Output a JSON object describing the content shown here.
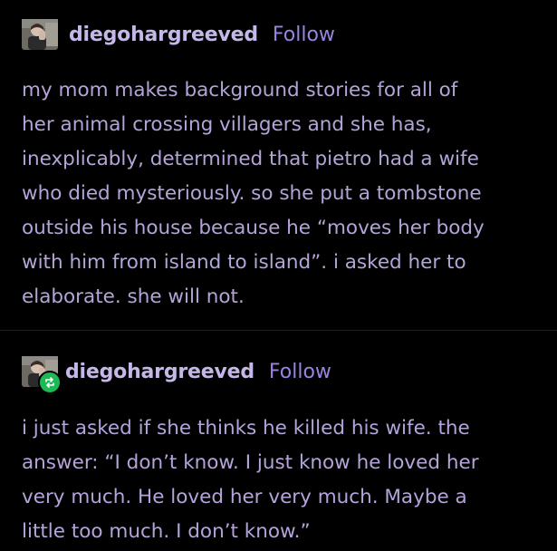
{
  "posts": [
    {
      "username": "diegohargreeved",
      "follow_label": "Follow",
      "avatar_icon": "user-avatar-icon",
      "reblogged": false,
      "lines": [
        "my mom makes background stories for all of",
        "her animal crossing villagers and she has,",
        "inexplicably, determined that pietro had a wife",
        "who died mysteriously. so she put a tombstone",
        "outside his house because he “moves her body",
        "with him from island to island”. i asked her to",
        "elaborate. she will not."
      ]
    },
    {
      "username": "diegohargreeved",
      "follow_label": "Follow",
      "avatar_icon": "user-avatar-icon",
      "reblogged": true,
      "badge_icon": "reblog-icon",
      "lines": [
        "i just asked if she thinks he killed his wife. the",
        "answer: “I don’t know. I just know he loved her",
        "very much. He loved her very much. Maybe a",
        "little too much. I don’t know.”"
      ]
    }
  ],
  "colors": {
    "background": "#000000",
    "text": "#b4a4da",
    "username": "#c5b7e8",
    "follow": "#9a83e0",
    "reblog_badge": "#1db954"
  }
}
